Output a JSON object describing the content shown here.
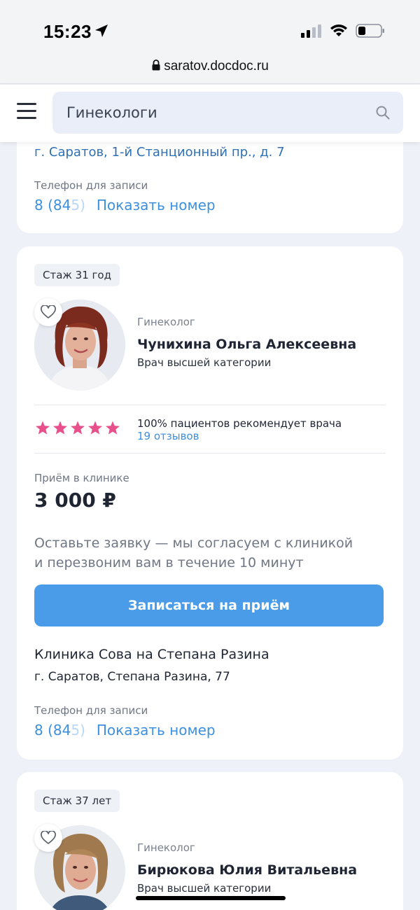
{
  "status_bar": {
    "time": "15:23",
    "url": "saratov.docdoc.ru"
  },
  "header": {
    "search_value": "Гинекологи"
  },
  "prev_card": {
    "address": "г. Саратов, 1-й Станционный пр., д. 7",
    "phone_label": "Телефон для записи",
    "phone_visible": "8 (84",
    "phone_faded": "5)",
    "show_number": "Показать номер"
  },
  "main_card": {
    "experience": "Стаж 31 год",
    "specialty": "Гинеколог",
    "name": "Чунихина Ольга Алексеевна",
    "category": "Врач высшей категории",
    "rating_stars": 5,
    "recommend": "100% пациентов рекомендует врача",
    "reviews": "19 отзывов",
    "priem_label": "Приём в клинике",
    "price": "3 000 ₽",
    "note_line1": "Оставьте заявку — мы согласуем с клиникой",
    "note_line2": "и перезвоним вам в течение 10 минут",
    "book_button": "Записаться на приём",
    "clinic_name": "Клиника Сова на Степана Разина",
    "clinic_address": "г. Саратов, Степана Разина, 77",
    "phone_label": "Телефон для записи",
    "phone_visible": "8 (84",
    "phone_faded": "5)",
    "show_number": "Показать номер"
  },
  "next_card": {
    "experience": "Стаж 37 лет",
    "specialty": "Гинеколог",
    "name": "Бирюкова Юлия Витальевна",
    "category": "Врач высшей категории"
  },
  "colors": {
    "accent": "#4a9be8",
    "link": "#3d8fe0",
    "star": "#e8508b",
    "background": "#eef1f7"
  },
  "icons": {
    "location": "location-arrow-icon",
    "lock": "lock-icon",
    "menu": "hamburger-menu-icon",
    "search": "search-icon",
    "favorite": "heart-icon",
    "rating": "star-icon"
  }
}
